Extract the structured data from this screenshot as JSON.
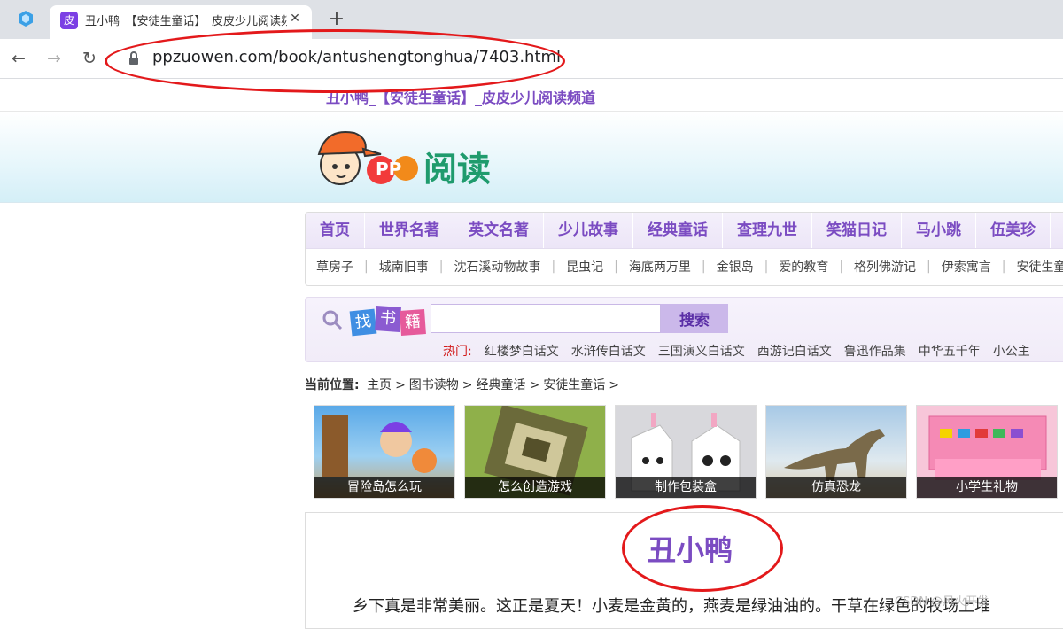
{
  "browser": {
    "tab_title": "丑小鸭_【安徒生童话】_皮皮少儿阅读频道",
    "tab_favicon": "皮",
    "tab_close": "✕",
    "new_tab": "+",
    "back": "←",
    "forward": "→",
    "reload": "↻",
    "url": "ppzuowen.com/book/antushengtonghua/7403.html"
  },
  "site": {
    "top_title": "丑小鸭_【安徒生童话】_皮皮少儿阅读频道",
    "logo_text": "阅读",
    "logo_pp": "PP"
  },
  "nav": {
    "main": [
      "首页",
      "世界名著",
      "英文名著",
      "少儿故事",
      "经典童话",
      "查理九世",
      "笑猫日记",
      "马小跳",
      "伍美珍"
    ],
    "sub": [
      "草房子",
      "城南旧事",
      "沈石溪动物故事",
      "昆虫记",
      "海底两万里",
      "金银岛",
      "爱的教育",
      "格列佛游记",
      "伊索寓言",
      "安徒生童话"
    ]
  },
  "search": {
    "logo": [
      "找",
      "书",
      "籍"
    ],
    "placeholder": "",
    "button": "搜索",
    "hot_label": "热门:",
    "hot_keywords": [
      "红楼梦白话文",
      "水浒传白话文",
      "三国演义白话文",
      "西游记白话文",
      "鲁迅作品集",
      "中华五千年",
      "小公主"
    ]
  },
  "breadcrumb": {
    "label": "当前位置:",
    "items": [
      "主页",
      "图书读物",
      "经典童话",
      "安徒生童话"
    ],
    "sep": ">"
  },
  "thumbs": [
    "冒险岛怎么玩",
    "怎么创造游戏",
    "制作包装盒",
    "仿真恐龙",
    "小学生礼物"
  ],
  "article": {
    "title": "丑小鸭",
    "text": "乡下真是非常美丽。这正是夏天！小麦是金黄的，燕麦是绿油油的。干草在绿色的牧场上堆"
  },
  "watermark": "CSDN @风火开发",
  "colors": {
    "accent": "#7b4cc2",
    "annotation": "#e3191b",
    "logo_green": "#1f9b6d"
  }
}
